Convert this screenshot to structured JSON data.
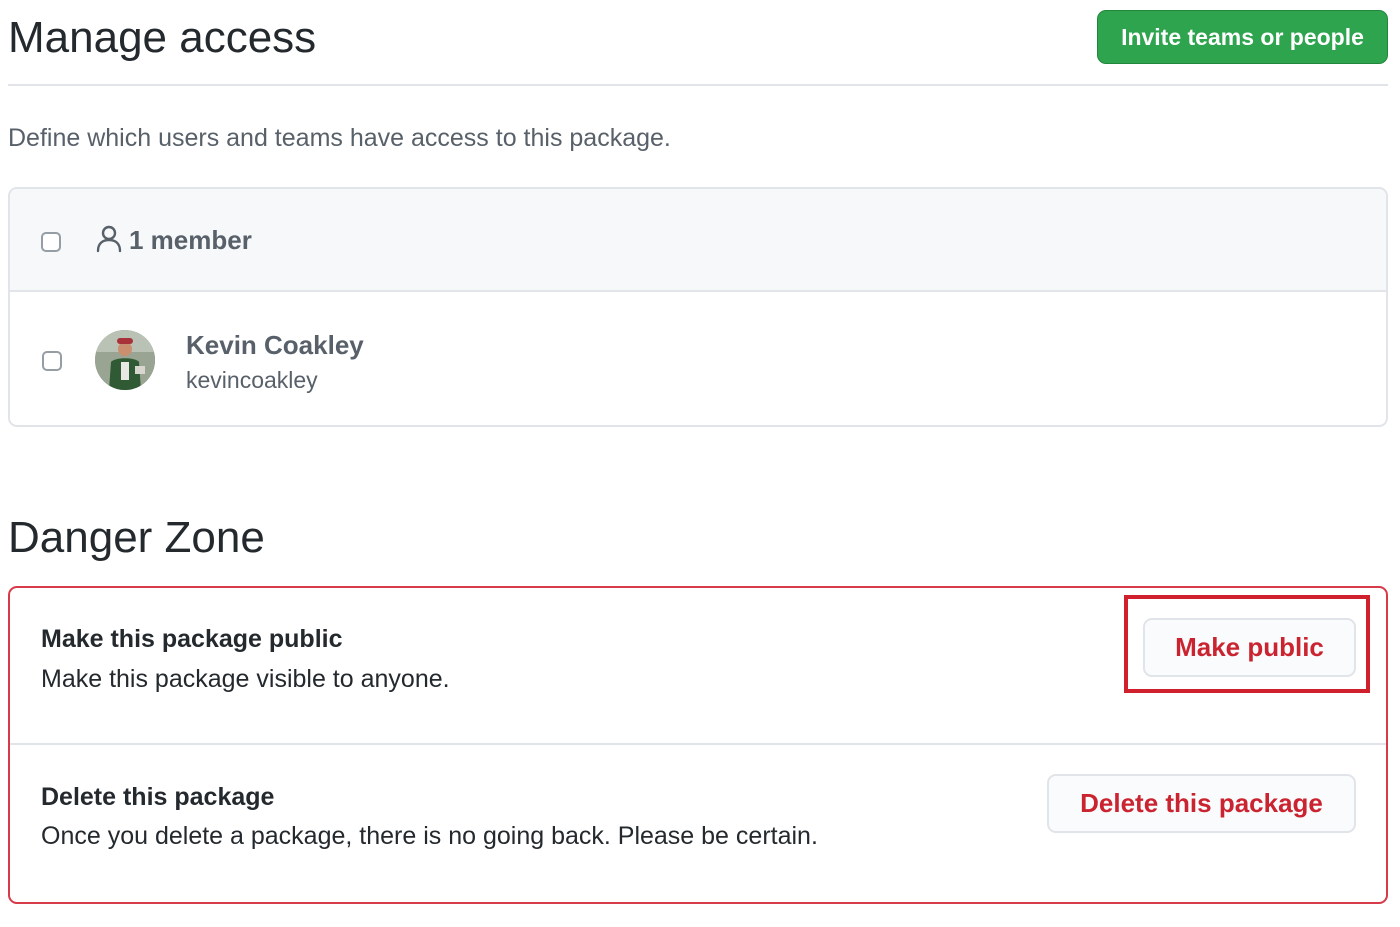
{
  "header": {
    "title": "Manage access",
    "invite_button_label": "Invite teams or people"
  },
  "description": "Define which users and teams have access to this package.",
  "members": {
    "count_label": "1 member",
    "count_icon": "person-icon",
    "rows": [
      {
        "name": "Kevin Coakley",
        "login": "kevincoakley"
      }
    ]
  },
  "danger_zone": {
    "title": "Danger Zone",
    "items": [
      {
        "title": "Make this package public",
        "description": "Make this package visible to anyone.",
        "button_label": "Make public",
        "highlighted": true
      },
      {
        "title": "Delete this package",
        "description": "Once you delete a package, there is no going back. Please be certain.",
        "button_label": "Delete this package",
        "highlighted": false
      }
    ]
  },
  "colors": {
    "primary_button": "#2ea44f",
    "danger": "#cb2431",
    "danger_border": "#d73a49",
    "highlight": "#d0202e"
  }
}
